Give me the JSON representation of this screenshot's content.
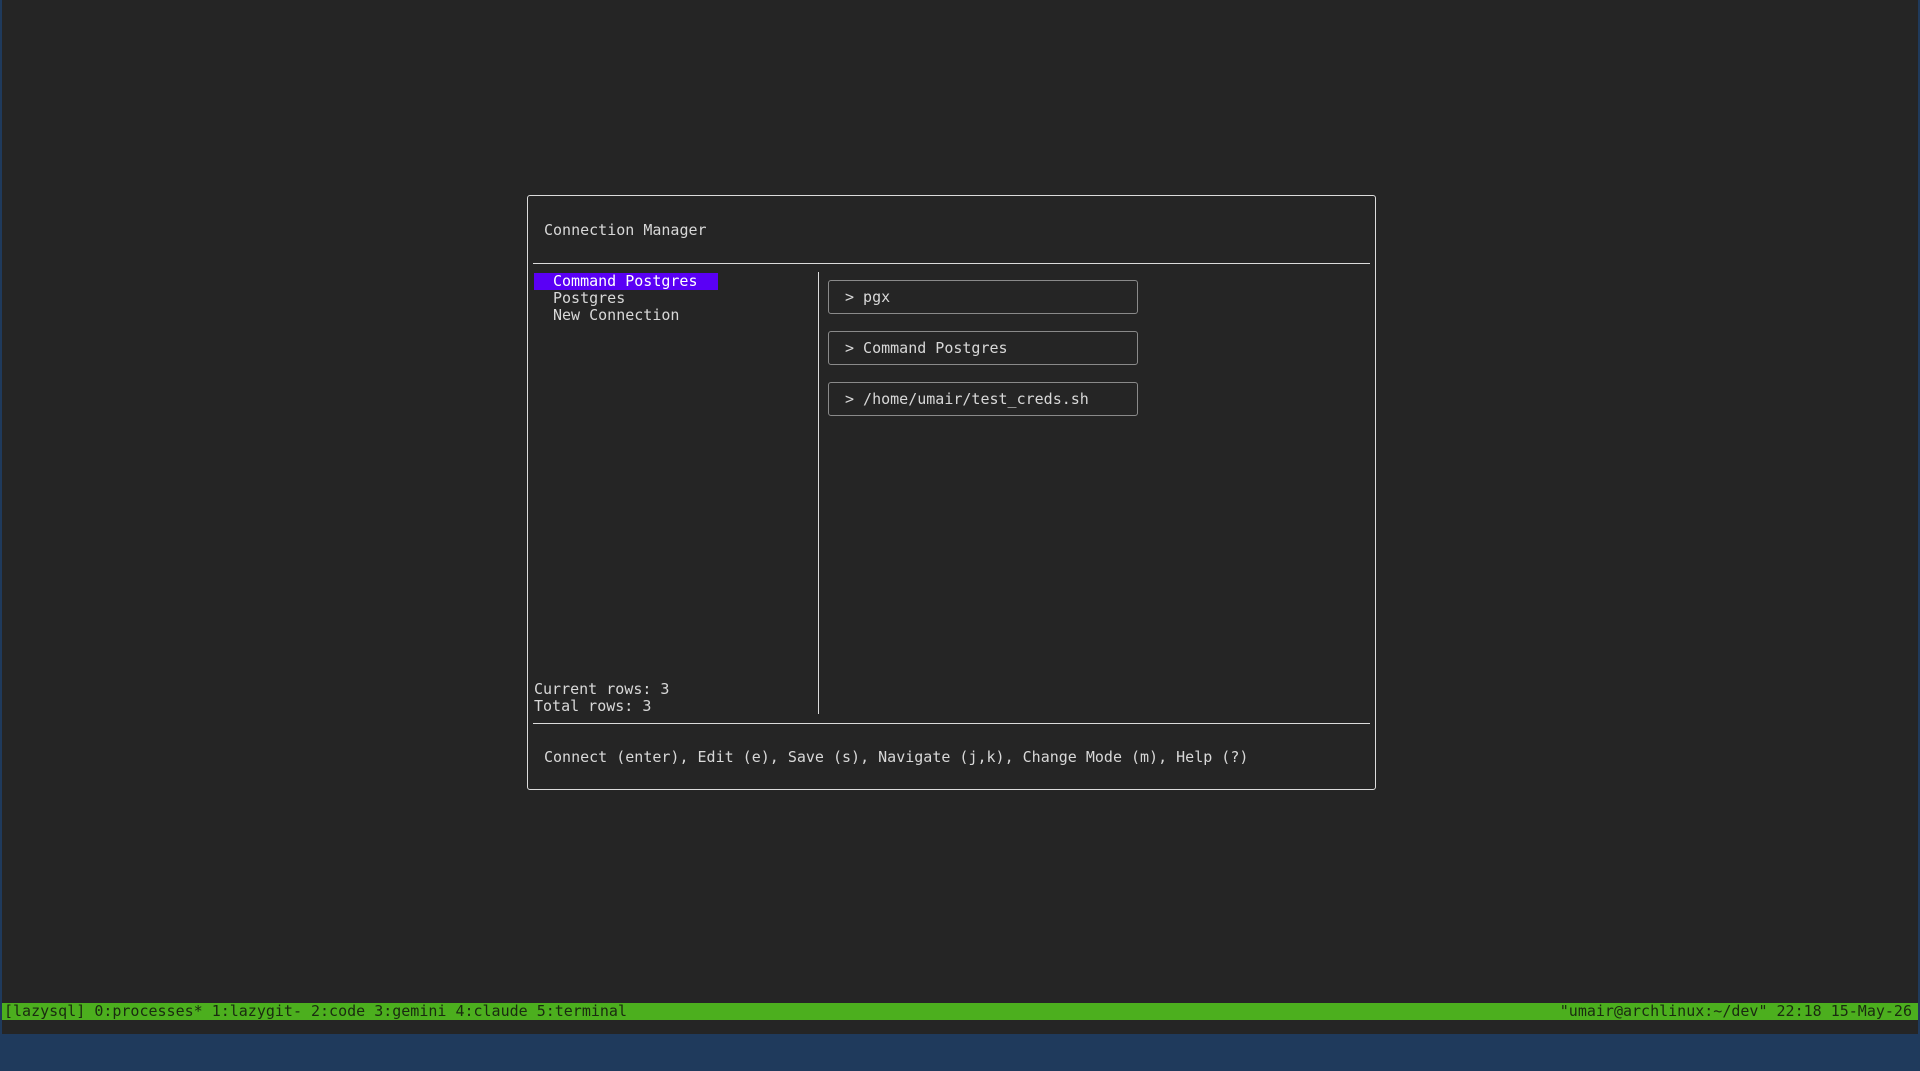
{
  "dialog": {
    "title": "Connection Manager",
    "connections": [
      {
        "label": "Command Postgres",
        "selected": true
      },
      {
        "label": "Postgres",
        "selected": false
      },
      {
        "label": "New Connection",
        "selected": false
      }
    ],
    "current_rows": "Current rows: 3",
    "total_rows": "Total rows: 3",
    "details": [
      "> pgx",
      "> Command Postgres",
      "> /home/umair/test_creds.sh"
    ],
    "help": "Connect (enter), Edit (e), Save (s), Navigate (j,k), Change Mode (m), Help (?)",
    "colors": {
      "selection": "#5a00f5",
      "border": "#dcdcdc",
      "background": "#252525"
    }
  },
  "status_bar": {
    "session": "[lazysql]",
    "windows": [
      "0:processes*",
      "1:lazygit-",
      "2:code",
      "3:gemini",
      "4:claude",
      "5:terminal"
    ],
    "host": "\"umair@archlinux:~/dev\"",
    "time": "22:18",
    "date": "15-May-26",
    "color": "#4caf1e"
  }
}
